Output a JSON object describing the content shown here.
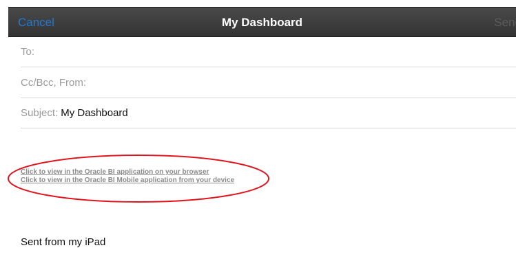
{
  "nav": {
    "cancel_label": "Cancel",
    "title": "My Dashboard",
    "send_label": "Send"
  },
  "fields": {
    "to_label": "To:",
    "to_value": "",
    "cc_label": "Cc/Bcc, From:",
    "cc_value": "",
    "subject_label": "Subject:",
    "subject_value": "My Dashboard"
  },
  "body": {
    "link_browser": "Click to view in the Oracle BI application on your browser",
    "link_mobile": "Click to view in the Oracle BI Mobile application from your device",
    "signature": "Sent from my iPad"
  },
  "colors": {
    "accent": "#1f7bd6",
    "annotation": "#e0141c"
  }
}
